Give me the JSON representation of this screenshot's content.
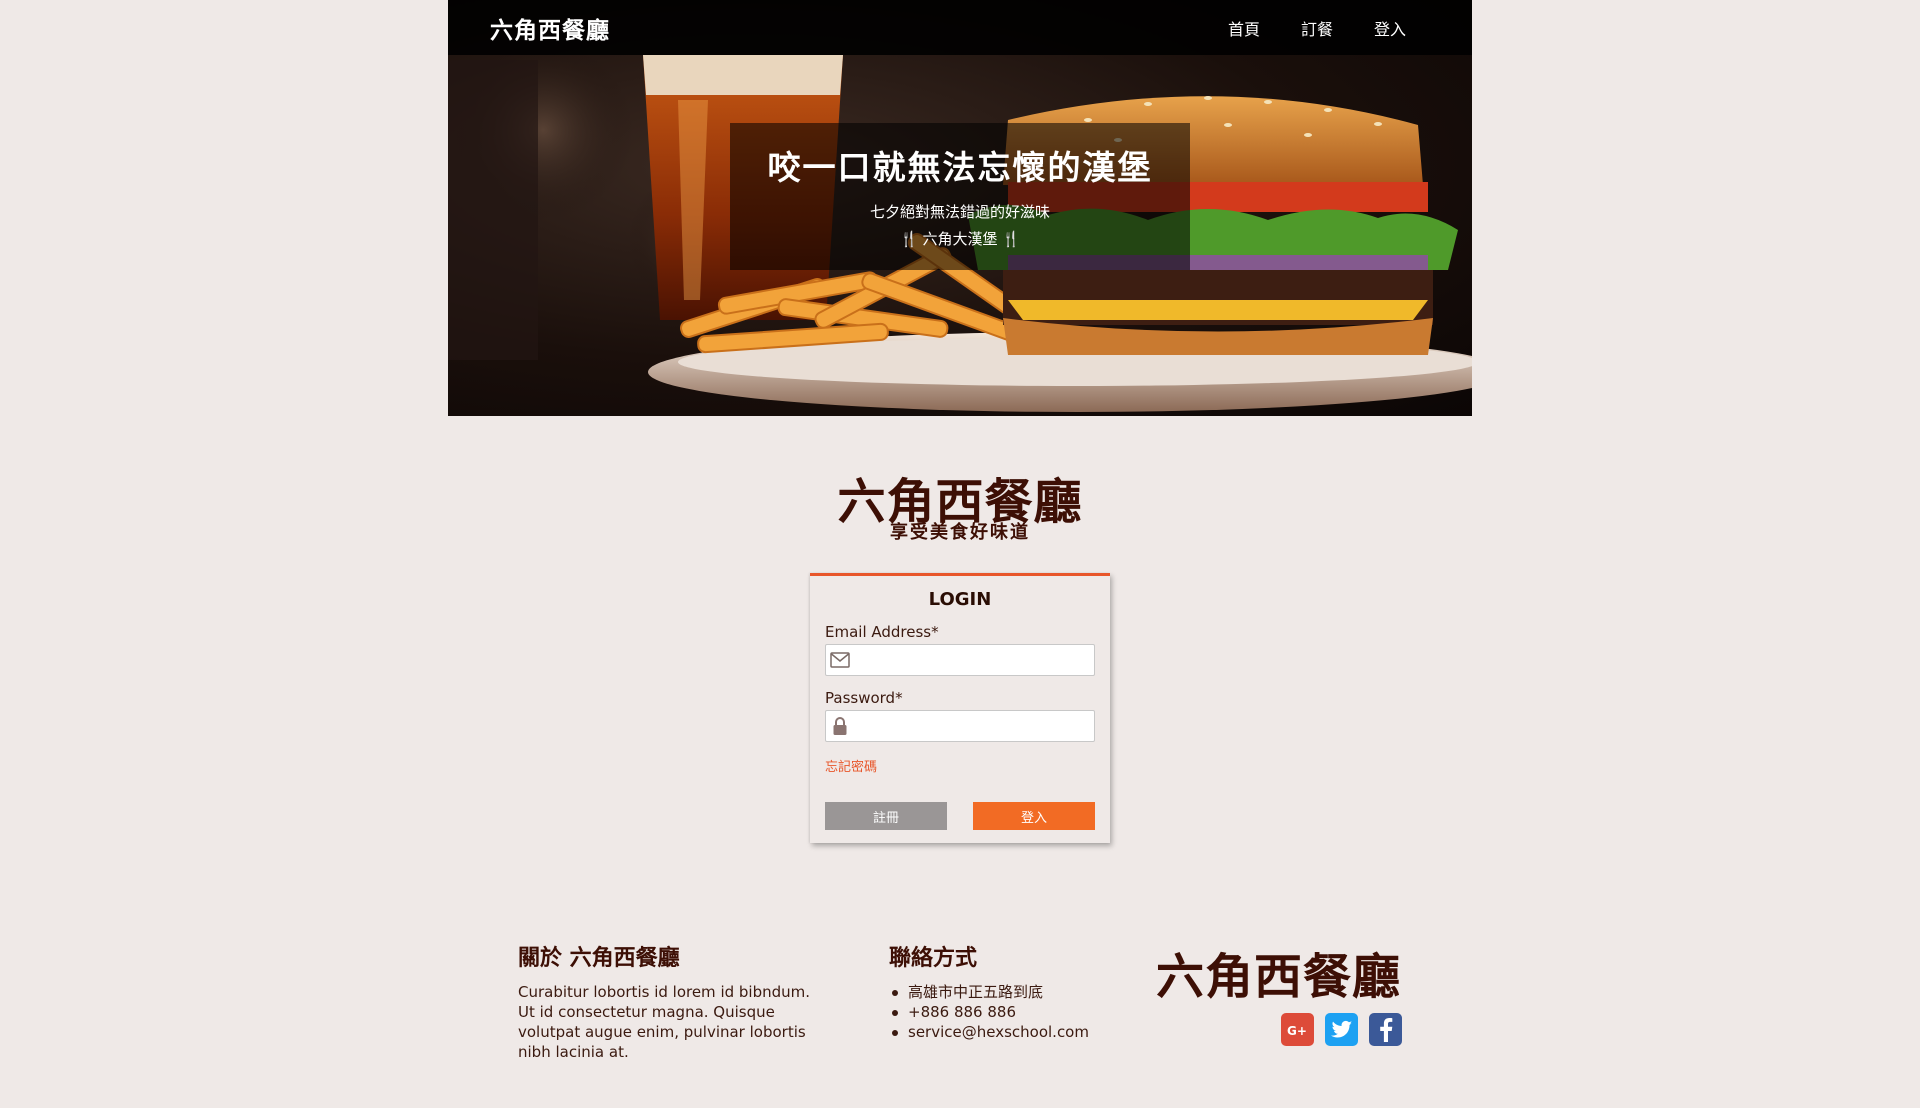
{
  "navbar": {
    "brand": "六角西餐廳",
    "links": [
      {
        "label": "首頁"
      },
      {
        "label": "訂餐"
      },
      {
        "label": "登入"
      }
    ]
  },
  "hero": {
    "title": "咬一口就無法忘懷的漢堡",
    "subtitle": "七夕絕對無法錯過的好滋味",
    "tagline_icon_left": "🍴",
    "tagline": "六角大漢堡",
    "tagline_icon_right": "🍴"
  },
  "logo": {
    "title": "六角西餐廳",
    "subtitle": "享受美食好味道"
  },
  "login": {
    "title": "LOGIN",
    "email_label": "Email Address*",
    "email_value": "",
    "email_icon": "envelope-icon",
    "password_label": "Password*",
    "password_value": "",
    "password_icon": "lock-icon",
    "forgot_label": "忘記密碼",
    "register_label": "註冊",
    "submit_label": "登入",
    "accent_color": "#e8562a",
    "submit_color": "#f26b24",
    "register_color": "#9a9696"
  },
  "footer": {
    "about_heading": "關於 六角西餐廳",
    "about_text": "Curabitur lobortis id lorem id bibndum. Ut id consectetur magna. Quisque volutpat augue enim, pulvinar lobortis nibh lacinia at.",
    "contact_heading": "聯絡方式",
    "contact_items": [
      {
        "text": "高雄市中正五路到底"
      },
      {
        "text": "+886 886 886"
      },
      {
        "text": "service@hexschool.com"
      }
    ],
    "logo": "六角西餐廳",
    "social": [
      {
        "icon": "google-plus-icon",
        "color": "#dd4b39"
      },
      {
        "icon": "twitter-icon",
        "color": "#1da1f2"
      },
      {
        "icon": "facebook-icon",
        "color": "#3b5998"
      }
    ]
  }
}
